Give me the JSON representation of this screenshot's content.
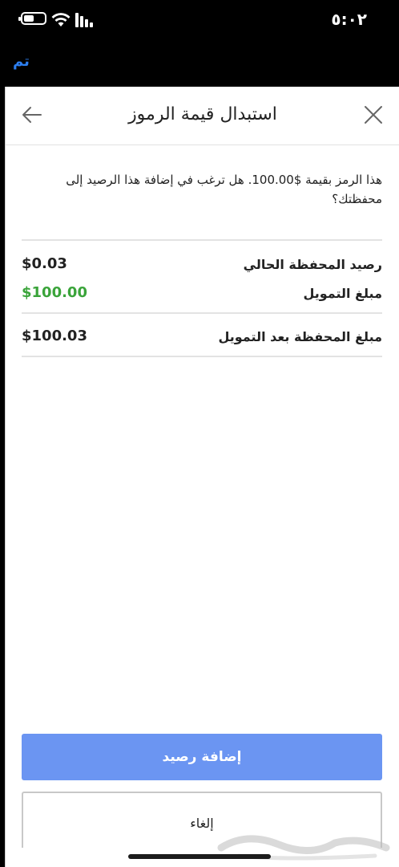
{
  "status_bar": {
    "time": "٥:٠٢",
    "icons": [
      "battery-icon",
      "wifi-icon",
      "signal-icon"
    ]
  },
  "app_bar": {
    "done_label": "تم"
  },
  "dialog": {
    "title": "استبدال قيمة الرموز",
    "back_icon": "arrow-left-icon",
    "close_icon": "close-icon",
    "message": "هذا الرمز بقيمة $100.00. هل ترغب في إضافة هذا الرصيد إلى محفظتك؟",
    "rows": [
      {
        "label": "رصيد المحفظة الحالي",
        "value": "$0.03",
        "color": "#222222"
      },
      {
        "label": "مبلغ التمويل",
        "value": "$100.00",
        "color": "#3aa43a"
      },
      {
        "label": "مبلغ المحفظة بعد التمويل",
        "value": "$100.03",
        "color": "#222222"
      }
    ],
    "primary_button": "إضافة رصيد",
    "secondary_button": "إلغاء"
  },
  "colors": {
    "primary": "#6b95f2",
    "link": "#2d7ff0",
    "positive": "#3aa43a"
  }
}
